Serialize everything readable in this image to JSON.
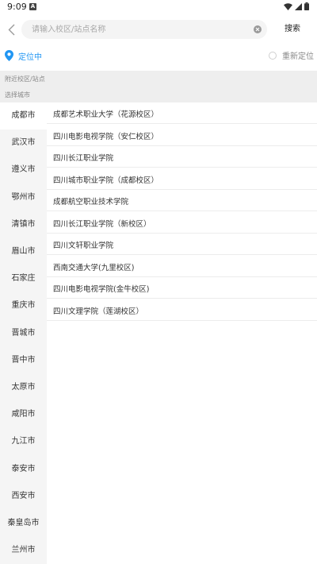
{
  "status_bar": {
    "time": "9:09",
    "notification_glyph": "A"
  },
  "search": {
    "placeholder": "请输入校区/站点名称",
    "value": "",
    "submit_label": "搜索"
  },
  "location": {
    "status_text": "定位中",
    "relocate_label": "重新定位",
    "accent_color": "#2196f3"
  },
  "sections": {
    "nearby_label": "附近校区/站点",
    "choose_city_label": "选择城市"
  },
  "cities": [
    {
      "name": "成都市",
      "active": true
    },
    {
      "name": "武汉市"
    },
    {
      "name": "遵义市"
    },
    {
      "name": "鄂州市"
    },
    {
      "name": "清镇市"
    },
    {
      "name": "眉山市"
    },
    {
      "name": "石家庄"
    },
    {
      "name": "重庆市"
    },
    {
      "name": "晋城市"
    },
    {
      "name": "晋中市"
    },
    {
      "name": "太原市"
    },
    {
      "name": "咸阳市"
    },
    {
      "name": "九江市"
    },
    {
      "name": "泰安市"
    },
    {
      "name": "西安市"
    },
    {
      "name": "秦皇岛市"
    },
    {
      "name": "兰州市"
    }
  ],
  "schools": [
    "成都艺术职业大学（花源校区）",
    "四川电影电视学院（安仁校区）",
    "四川长江职业学院",
    "四川城市职业学院（成都校区）",
    "成都航空职业技术学院",
    "四川长江职业学院（新校区）",
    "四川文轩职业学院",
    "西南交通大学(九里校区)",
    "四川电影电视学院(金牛校区)",
    "四川文理学院（莲湖校区）"
  ]
}
